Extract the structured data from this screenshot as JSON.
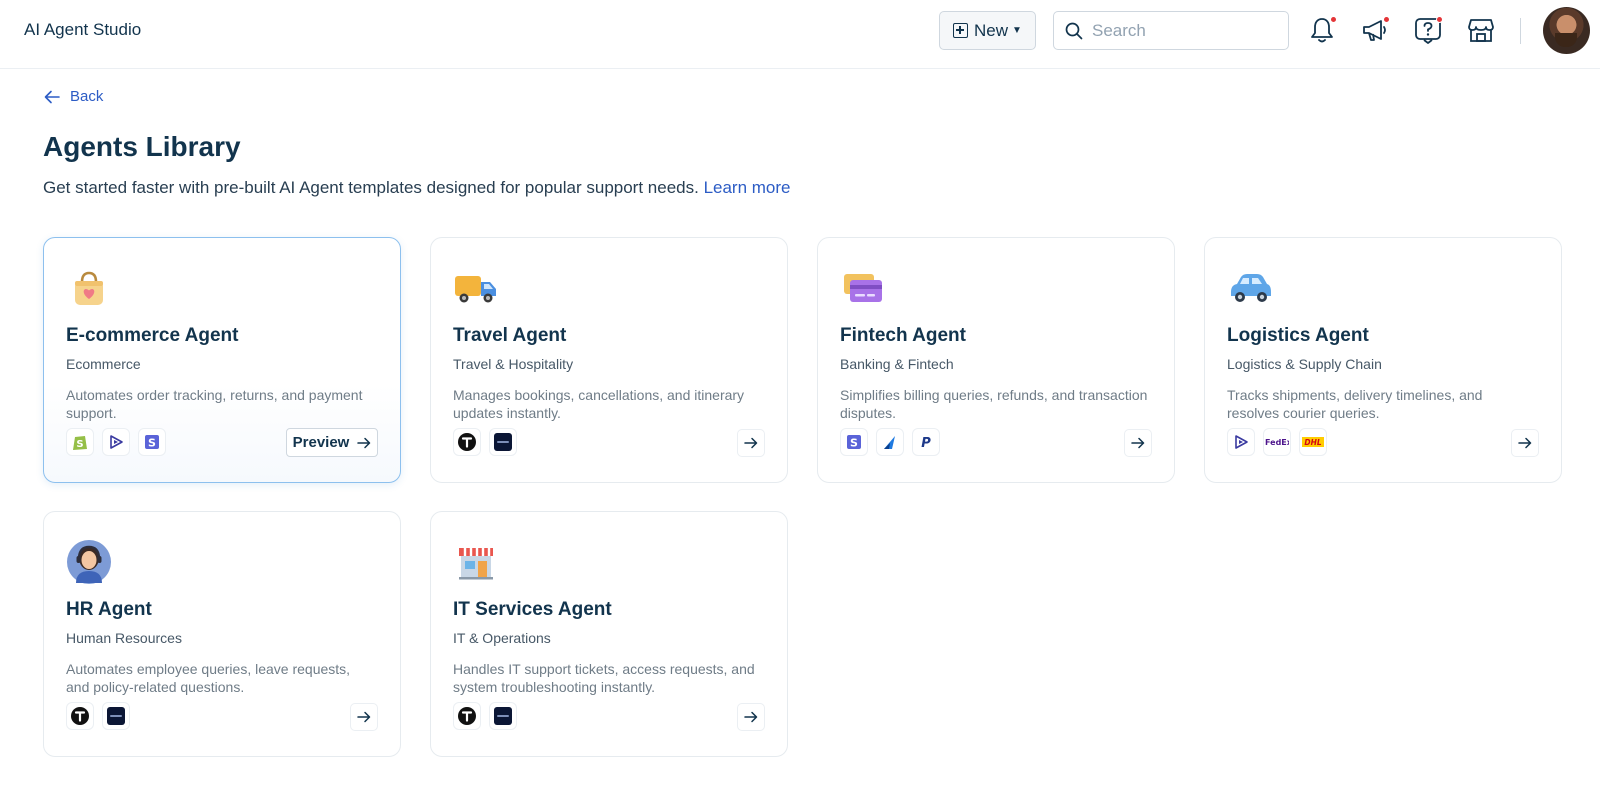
{
  "header": {
    "app_title": "AI Agent Studio",
    "new_label": "New",
    "search_placeholder": "Search"
  },
  "nav": {
    "back_label": "Back"
  },
  "page": {
    "title": "Agents Library",
    "subtitle": "Get started faster with pre-built AI Agent templates designed for popular support needs.",
    "learn_more": "Learn more"
  },
  "preview_label": "Preview",
  "agents": [
    {
      "name": "E-commerce Agent",
      "category": "Ecommerce",
      "description": "Automates order tracking, returns, and payment support.",
      "icon": "shopping-bag-icon",
      "logos": [
        "shopify-logo",
        "play-logo",
        "stripe-logo"
      ]
    },
    {
      "name": "Travel Agent",
      "category": "Travel & Hospitality",
      "description": "Manages bookings, cancellations, and itinerary updates instantly.",
      "icon": "delivery-truck-icon",
      "logos": [
        "t-logo",
        "amadeus-logo"
      ]
    },
    {
      "name": "Fintech Agent",
      "category": "Banking & Fintech",
      "description": "Simplifies billing queries, refunds, and transaction disputes.",
      "icon": "credit-card-icon",
      "logos": [
        "stripe-logo",
        "sail-logo",
        "paypal-logo"
      ]
    },
    {
      "name": "Logistics Agent",
      "category": "Logistics & Supply Chain",
      "description": "Tracks shipments, delivery timelines, and resolves courier queries.",
      "icon": "car-icon",
      "logos": [
        "play-logo",
        "fedex-logo",
        "dhl-logo"
      ]
    },
    {
      "name": "HR Agent",
      "category": "Human Resources",
      "description": "Automates employee queries, leave requests, and policy-related questions.",
      "icon": "support-person-icon",
      "logos": [
        "t-logo",
        "amadeus-logo"
      ]
    },
    {
      "name": "IT Services Agent",
      "category": "IT & Operations",
      "description": "Handles IT support tickets, access requests, and system troubleshooting instantly.",
      "icon": "storefront-icon",
      "logos": [
        "t-logo",
        "amadeus-logo"
      ]
    }
  ],
  "logo_text": {
    "fedex": "FedEx",
    "dhl": "DHL"
  },
  "colors": {
    "link": "#2c5cc5",
    "active_card_border": "#8dc0ee",
    "notification_dot": "#e43538"
  }
}
